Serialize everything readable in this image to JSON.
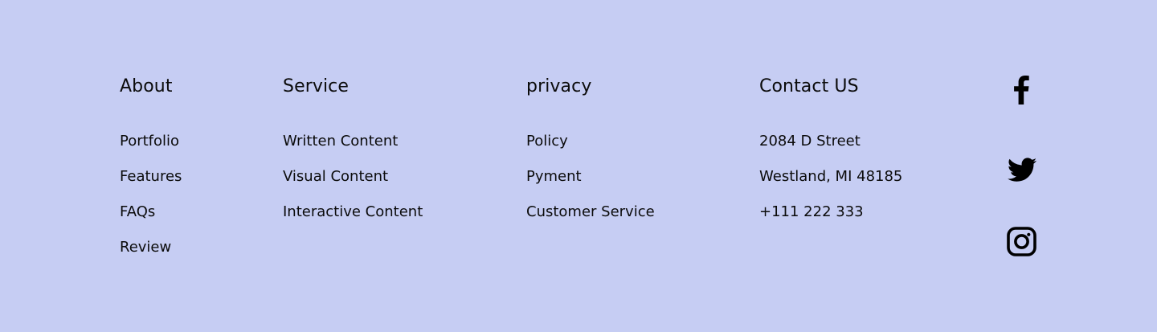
{
  "footer": {
    "about": {
      "title": "About",
      "items": [
        "Portfolio",
        "Features",
        "FAQs",
        "Review"
      ]
    },
    "service": {
      "title": "Service",
      "items": [
        "Written Content",
        "Visual Content",
        "Interactive Content"
      ]
    },
    "privacy": {
      "title": "privacy",
      "items": [
        "Policy",
        "Pyment",
        "Customer Service"
      ]
    },
    "contact": {
      "title": "Contact US",
      "items": [
        "2084 D Street",
        "Westland, MI 48185",
        "+111 222 333"
      ]
    },
    "social": [
      {
        "icon": "facebook-icon"
      },
      {
        "icon": "twitter-icon"
      },
      {
        "icon": "instagram-icon"
      }
    ]
  },
  "colors": {
    "background": "#c6cdf3",
    "text": "#0b0b0b"
  }
}
